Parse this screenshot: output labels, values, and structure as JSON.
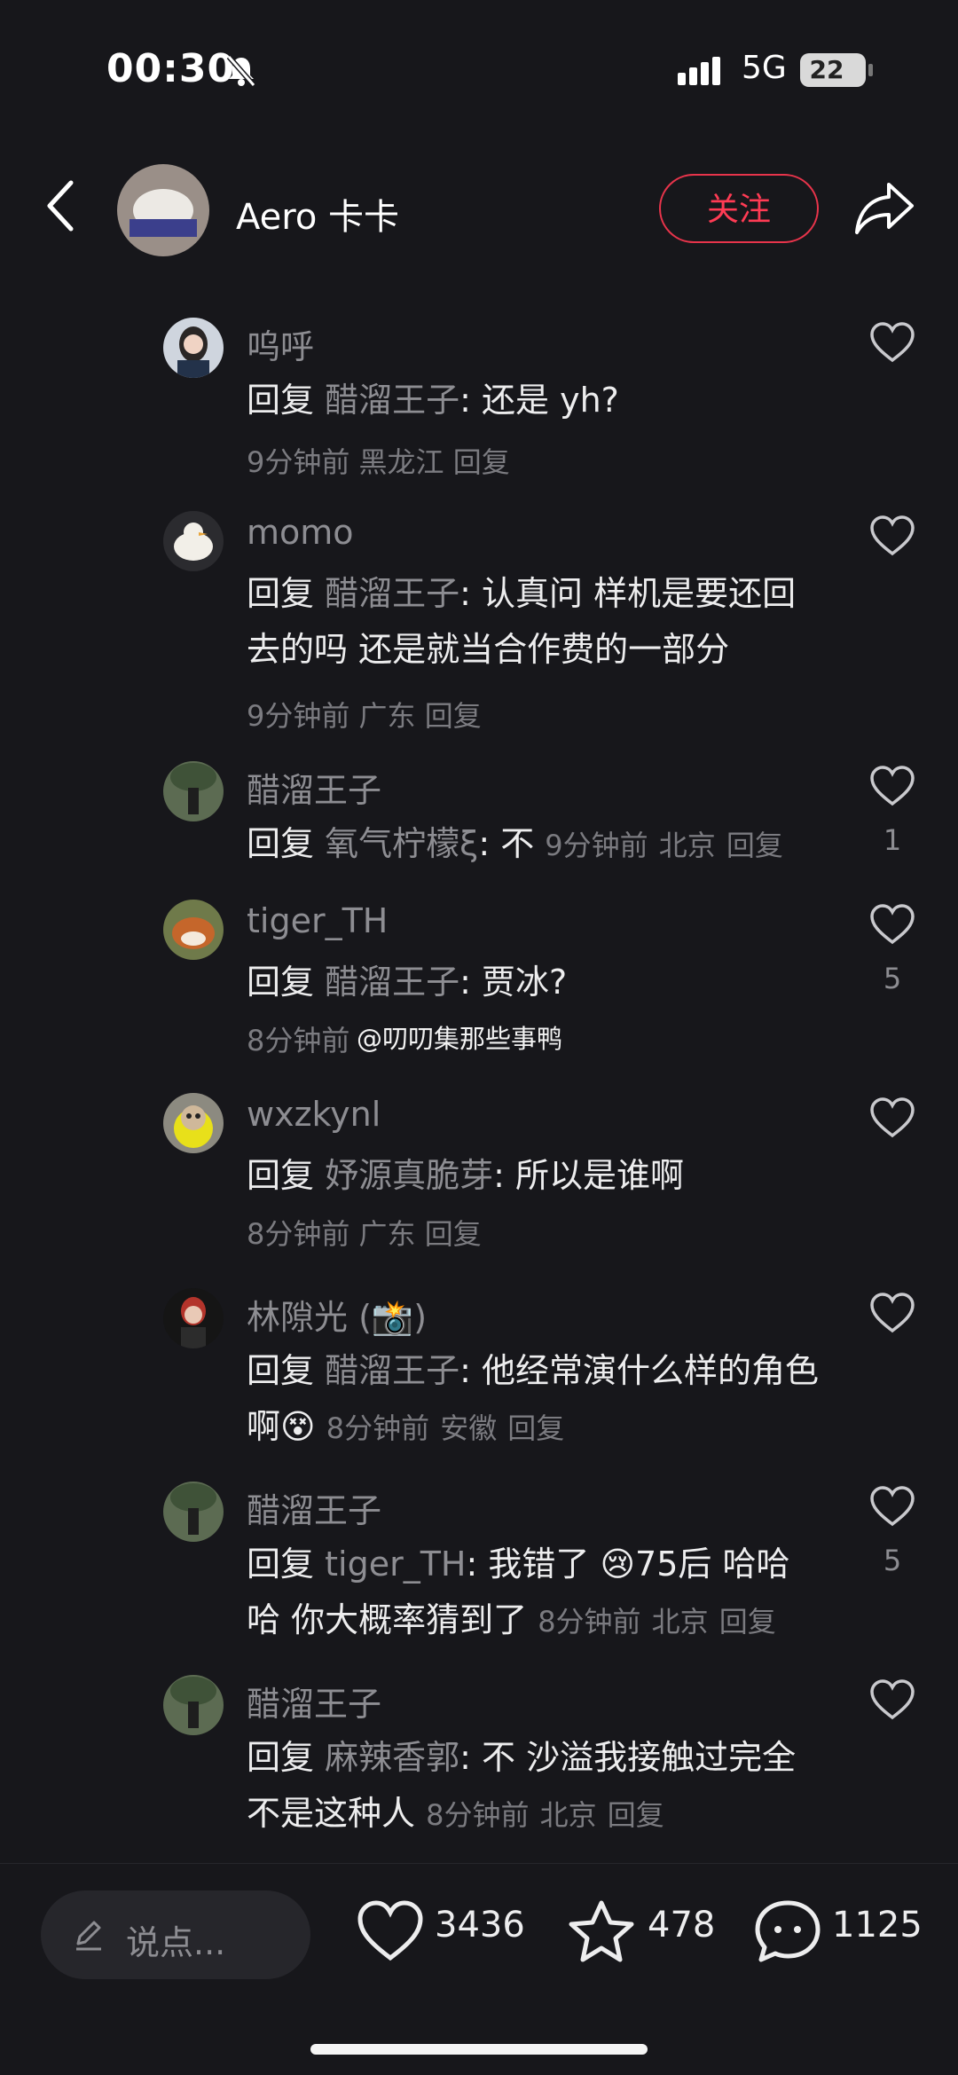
{
  "status_bar": {
    "time": "00:30",
    "network": "5G",
    "battery": "22"
  },
  "header": {
    "author": "Aero 卡卡",
    "follow_label": "关注"
  },
  "comments": [
    {
      "name": "呜呼",
      "reply_label": "回复",
      "reply_to": "醋溜王子",
      "text": ": 还是 yh?",
      "time": "9分钟前",
      "location": "黑龙江",
      "reply_action": "回复",
      "likes": ""
    },
    {
      "name": "momo",
      "reply_label": "回复",
      "reply_to": "醋溜王子",
      "text": ": 认真问 样机是要还回去的吗 还是就当合作费的一部分",
      "time": "9分钟前",
      "location": "广东",
      "reply_action": "回复",
      "likes": ""
    },
    {
      "name": "醋溜王子",
      "reply_label": "回复",
      "reply_to": "氧气柠檬ξ",
      "text": ": 不",
      "time": "9分钟前",
      "location": "北京",
      "reply_action": "回复",
      "likes": "1"
    },
    {
      "name": "tiger_TH",
      "reply_label": "回复",
      "reply_to": "醋溜王子",
      "text": ": 贾冰?",
      "time": "8分钟前",
      "location": "",
      "reply_action": "",
      "likes": "5"
    },
    {
      "name": "wxzkynl",
      "reply_label": "回复",
      "reply_to": "妤源真脆芽",
      "text": ": 所以是谁啊",
      "time": "8分钟前",
      "location": "广东",
      "reply_action": "回复",
      "likes": ""
    },
    {
      "name": "林隙光 (📸)",
      "reply_label": "回复",
      "reply_to": "醋溜王子",
      "text": ": 他经常演什么样的角色啊😵",
      "time": "8分钟前",
      "location": "安徽",
      "reply_action": "回复",
      "likes": ""
    },
    {
      "name": "醋溜王子",
      "reply_label": "回复",
      "reply_to": "tiger_TH",
      "text": ": 我错了 😢75后 哈哈哈 你大概率猜到了",
      "time": "8分钟前",
      "location": "北京",
      "reply_action": "回复",
      "likes": "5"
    },
    {
      "name": "醋溜王子",
      "reply_label": "回复",
      "reply_to": "麻辣香郭",
      "text": ": 不 沙溢我接触过完全不是这种人",
      "time": "8分钟前",
      "location": "北京",
      "reply_action": "回复",
      "likes": ""
    }
  ],
  "watermark": "@叨叨集那些事鸭",
  "bottom_bar": {
    "input_placeholder": "说点...",
    "likes": "3436",
    "favorites": "478",
    "comments": "1125"
  },
  "colors": {
    "background": "#17171b",
    "accent": "#ff3b54",
    "muted_text": "#8d8d92"
  }
}
